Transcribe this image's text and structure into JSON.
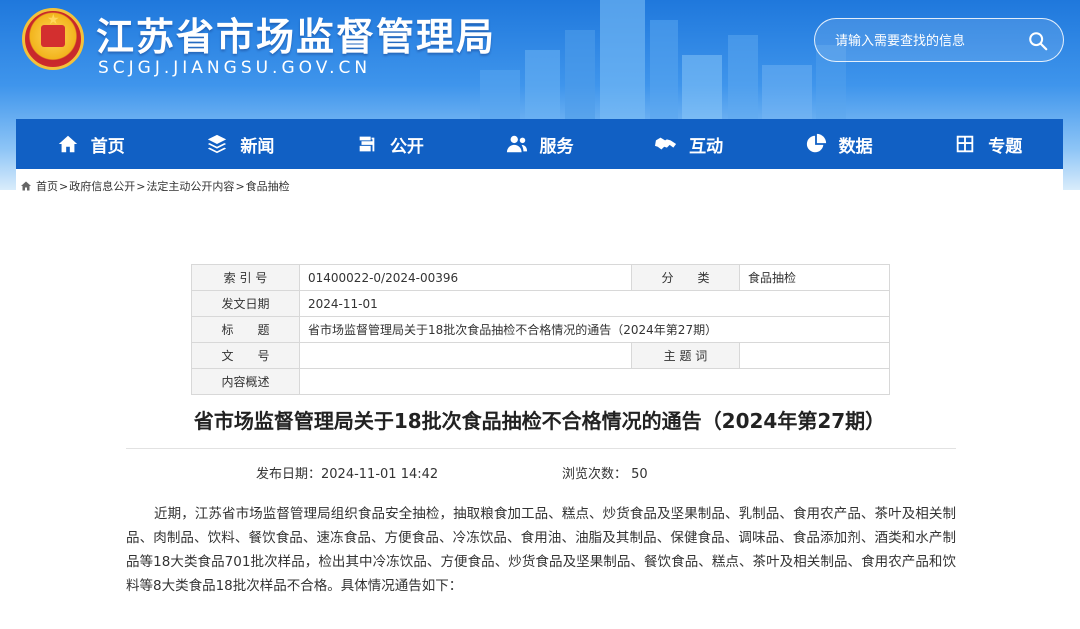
{
  "header": {
    "site_title": "江苏省市场监督管理局",
    "site_domain": "SCJGJ.JIANGSU.GOV.CN",
    "search_placeholder": "请输入需要查找的信息"
  },
  "nav": [
    {
      "label": "首页",
      "icon": "home-icon"
    },
    {
      "label": "新闻",
      "icon": "layers-icon"
    },
    {
      "label": "公开",
      "icon": "documents-icon"
    },
    {
      "label": "服务",
      "icon": "people-icon"
    },
    {
      "label": "互动",
      "icon": "handshake-icon"
    },
    {
      "label": "数据",
      "icon": "pie-chart-icon"
    },
    {
      "label": "专题",
      "icon": "grid-icon"
    }
  ],
  "breadcrumb": [
    "首页",
    "政府信息公开",
    "法定主动公开内容",
    "食品抽检"
  ],
  "meta": {
    "index_label": "索 引 号",
    "index_value": "01400022-0/2024-00396",
    "category_label": "分　　类",
    "category_value": "食品抽检",
    "date_label": "发文日期",
    "date_value": "2024-11-01",
    "title_label": "标　　题",
    "title_value": "省市场监督管理局关于18批次食品抽检不合格情况的通告（2024年第27期）",
    "docno_label": "文　　号",
    "docno_value": "",
    "subject_label": "主 题 词",
    "subject_value": "",
    "summary_label": "内容概述",
    "summary_value": ""
  },
  "article": {
    "title": "省市场监督管理局关于18批次食品抽检不合格情况的通告（2024年第27期）",
    "publish_label": "发布日期：",
    "publish_time": "2024-11-01 14:42",
    "views_label": "浏览次数：",
    "views": "50",
    "body": "近期，江苏省市场监督管理局组织食品安全抽检，抽取粮食加工品、糕点、炒货食品及坚果制品、乳制品、食用农产品、茶叶及相关制品、肉制品、饮料、餐饮食品、速冻食品、方便食品、冷冻饮品、食用油、油脂及其制品、保健食品、调味品、食品添加剂、酒类和水产制品等18大类食品701批次样品，检出其中冷冻饮品、方便食品、炒货食品及坚果制品、餐饮食品、糕点、茶叶及相关制品、食用农产品和饮料等8大类食品18批次样品不合格。具体情况通告如下："
  },
  "colors": {
    "nav_bg": "#1160c4",
    "header_top": "#1f78dc",
    "emblem_red": "#d32f2f",
    "emblem_gold": "#f2b41c"
  }
}
